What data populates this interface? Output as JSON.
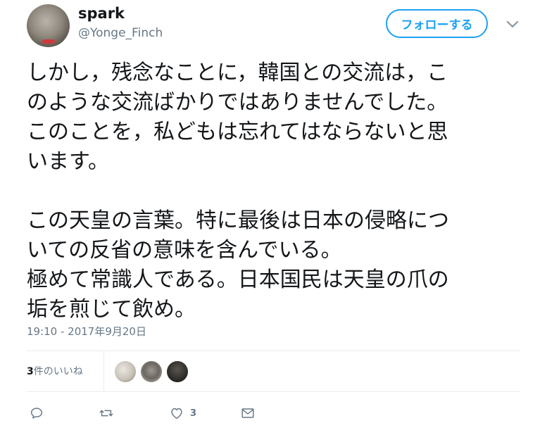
{
  "user": {
    "display_name": "spark",
    "handle": "@Yonge_Finch"
  },
  "follow_button": {
    "label": "フォローする"
  },
  "tweet": {
    "text": "しかし，残念なことに，韓国との交流は，こ\nのような交流ばかりではありませんでした。\nこのことを，私どもは忘れてはならないと思\nいます。\n\nこの天皇の言葉。特に最後は日本の侵略につ\nいての反省の意味を含んでいる。\n極めて常識人である。日本国民は天皇の爪の\n垢を煎じて飲め。",
    "timestamp": "19:10 - 2017年9月20日"
  },
  "likes": {
    "count": "3",
    "label": "件のいいね"
  },
  "actions": {
    "like_count": "3"
  },
  "icons": {
    "reply": "reply-icon",
    "retweet": "retweet-icon",
    "like": "heart-icon",
    "dm": "envelope-icon",
    "caret": "chevron-down-icon"
  },
  "colors": {
    "accent": "#1da1f2",
    "text": "#14171a",
    "muted": "#657786",
    "divider": "#e6ecf0"
  }
}
